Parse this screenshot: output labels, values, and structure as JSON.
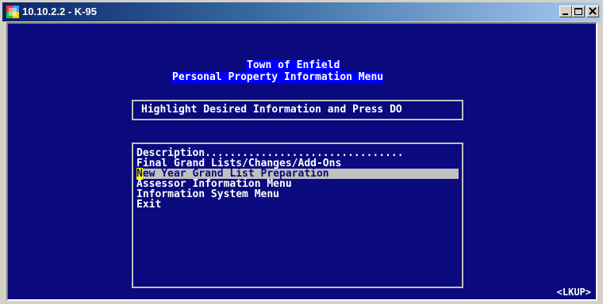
{
  "window": {
    "title": "10.10.2.2 - K-95",
    "icons": {
      "app": "terminal-app-icon",
      "minimize": "minimize-icon",
      "maximize": "maximize-icon",
      "close": "close-icon"
    }
  },
  "screen": {
    "heading_line1": "Town of Enfield",
    "heading_line2": "Personal Property Information Menu",
    "prompt": "Highlight Desired Information and Press DO",
    "menu": {
      "items": [
        "Description................................",
        "Final Grand Lists/Changes/Add-Ons",
        "New Year Grand List Preparation",
        "Assessor Information Menu",
        "Information System Menu",
        "Exit"
      ],
      "selected_index": 2,
      "selected_first_char": "N",
      "selected_rest": "ew Year Grand List Preparation"
    },
    "status_key": "<LKUP>"
  },
  "colors": {
    "background": "#0a0a7e",
    "title_highlight": "#0000ff",
    "selection": "#c0c0c0",
    "cursor": "#ffff00"
  }
}
